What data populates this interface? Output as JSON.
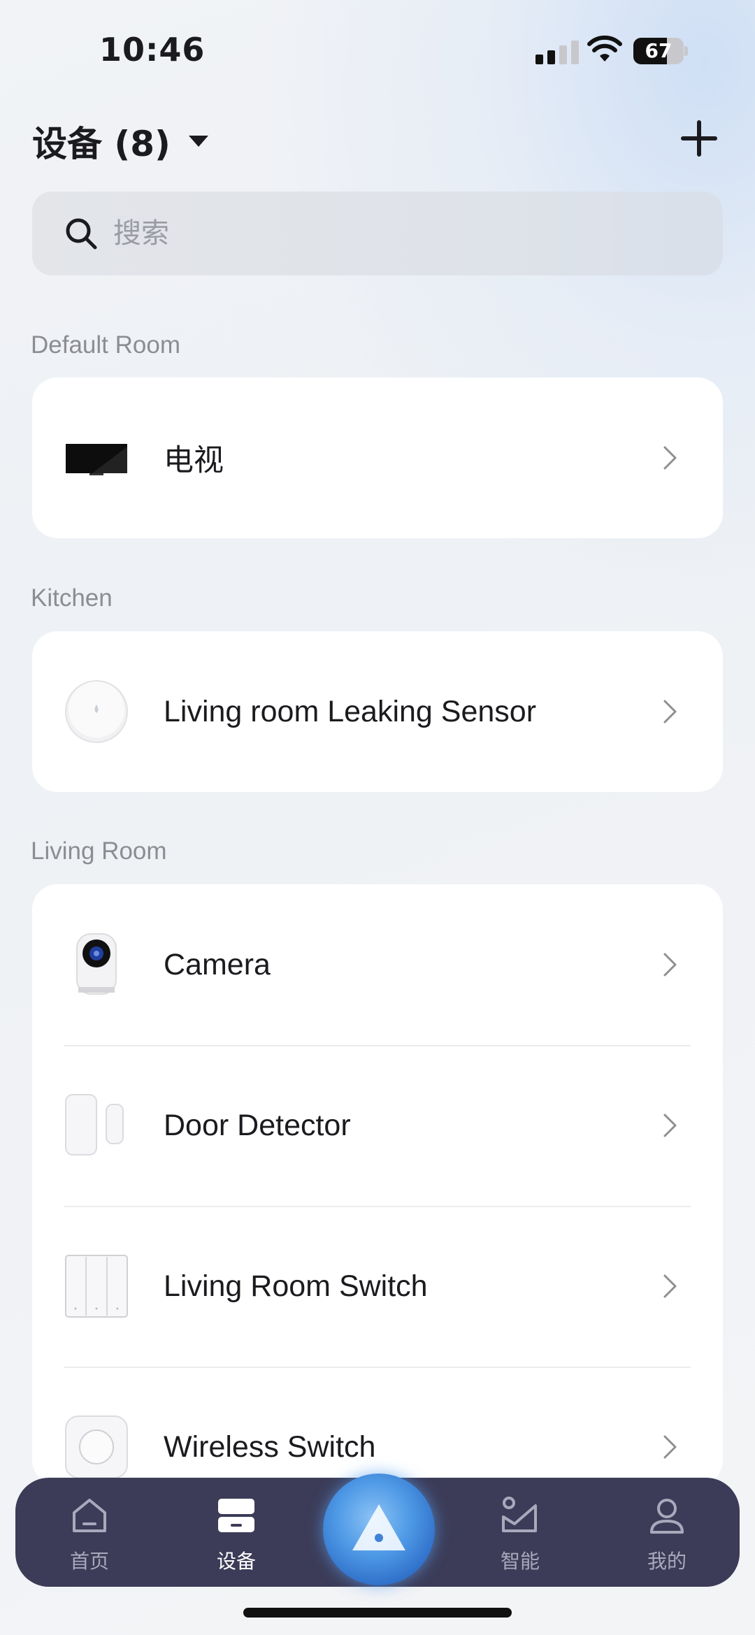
{
  "status_bar": {
    "time": "10:46",
    "battery": "67",
    "battery_level": 0.67
  },
  "header": {
    "title": "设备 (8)"
  },
  "search": {
    "placeholder": "搜索"
  },
  "sections": [
    {
      "label": "Default Room",
      "devices": [
        {
          "name": "电视",
          "icon": "tv-icon"
        }
      ]
    },
    {
      "label": "Kitchen",
      "devices": [
        {
          "name": "Living room Leaking Sensor",
          "icon": "leak-sensor-icon"
        }
      ]
    },
    {
      "label": "Living Room",
      "devices": [
        {
          "name": "Camera",
          "icon": "camera-icon"
        },
        {
          "name": "Door Detector",
          "icon": "door-detector-icon"
        },
        {
          "name": "Living Room Switch",
          "icon": "wall-switch-icon"
        },
        {
          "name": "Wireless Switch",
          "icon": "wireless-switch-icon"
        }
      ]
    }
  ],
  "tabbar": {
    "tabs": [
      {
        "label": "首页",
        "icon": "home-icon",
        "active": false
      },
      {
        "label": "设备",
        "icon": "devices-icon",
        "active": true
      },
      {
        "label": "智能",
        "icon": "automation-icon",
        "active": false
      },
      {
        "label": "我的",
        "icon": "profile-icon",
        "active": false
      }
    ],
    "center_icon": "assistant-orb-icon"
  },
  "colors": {
    "tabbar_bg": "#3c3c58",
    "tab_active": "#ffffff",
    "tab_inactive": "#a9a9bd",
    "section_label": "#8b8d93"
  }
}
